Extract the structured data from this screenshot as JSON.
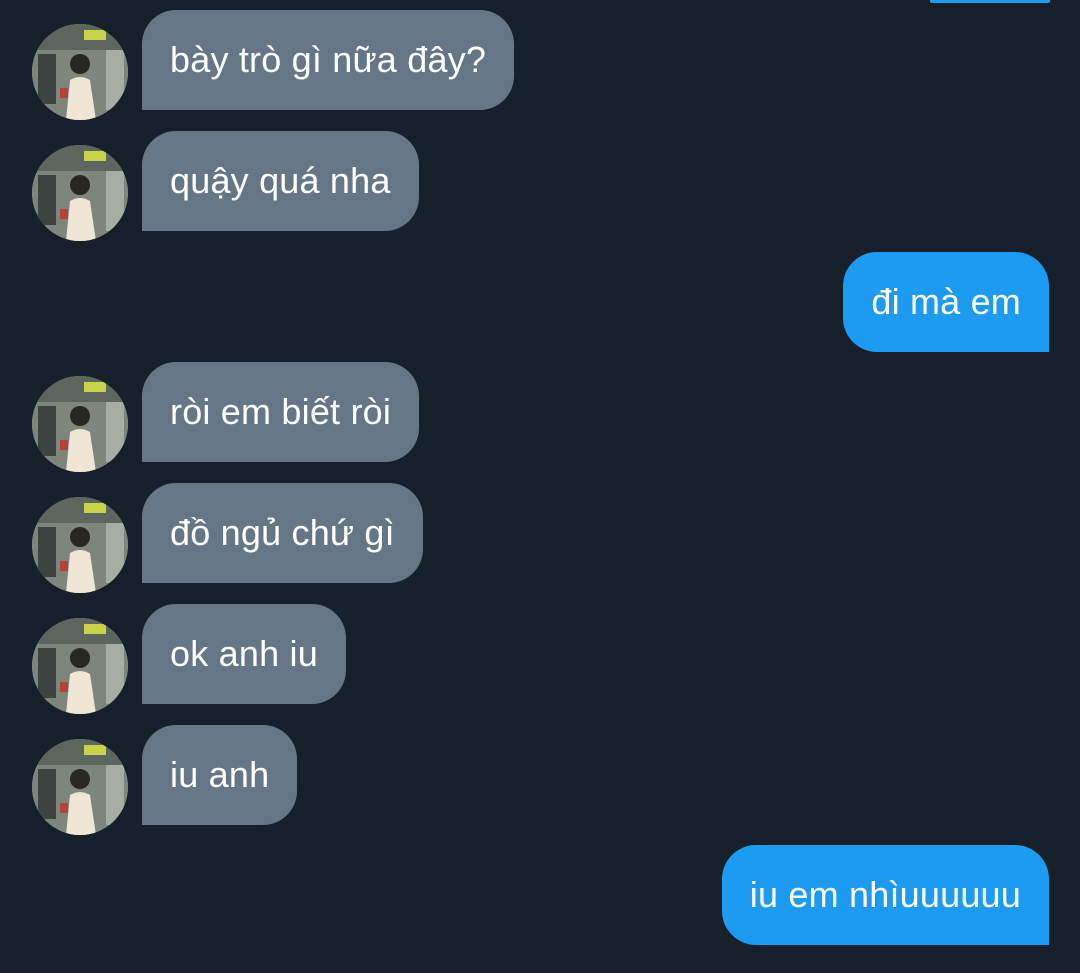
{
  "conversation": {
    "messages": [
      {
        "sender": "contact",
        "text": "bày trò gì nữa đây?"
      },
      {
        "sender": "contact",
        "text": "quậy quá nha"
      },
      {
        "sender": "me",
        "text": "đi mà em"
      },
      {
        "sender": "contact",
        "text": "ròi em biết ròi"
      },
      {
        "sender": "contact",
        "text": "đồ ngủ chứ gì"
      },
      {
        "sender": "contact",
        "text": "ok anh iu"
      },
      {
        "sender": "contact",
        "text": "iu anh"
      },
      {
        "sender": "me",
        "text": "iu em nhìuuuuuu"
      }
    ]
  },
  "colors": {
    "background": "#16202b",
    "received_bubble": "#657786",
    "sent_bubble": "#1d9bf0",
    "text": "#ffffff"
  }
}
